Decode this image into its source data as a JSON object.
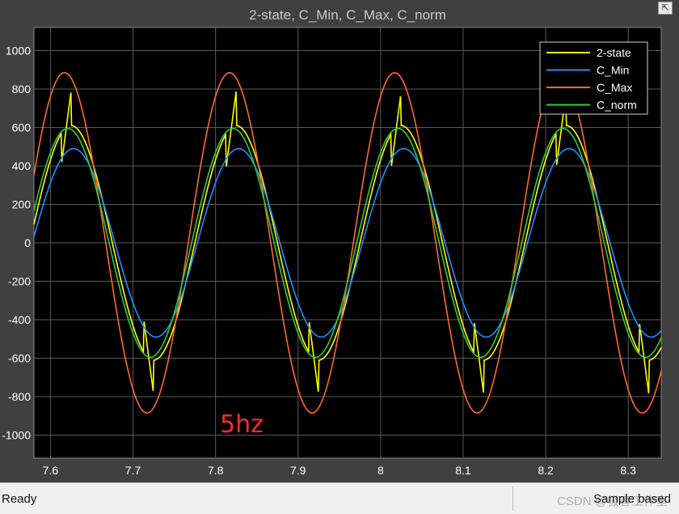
{
  "window": {
    "title": "2-state, C_Min, C_Max, C_norm",
    "undock_icon": "undock-icon"
  },
  "annotation": {
    "text": "5hz",
    "color": "#ff2a2a"
  },
  "status": {
    "left_text": "Ready",
    "right_text": "Sample based",
    "watermark": "CSDN @极客工作室"
  },
  "colors": {
    "plot_background": "#000000",
    "frame_background": "#404040",
    "grid": "#5a5a5a",
    "axis_text": "#ffffff",
    "title_text": "#c8c8c8"
  },
  "chart_data": {
    "type": "line",
    "title": "2-state, C_Min, C_Max, C_norm",
    "xlabel": "",
    "ylabel": "",
    "xlim": [
      7.58,
      8.34
    ],
    "ylim": [
      -1120,
      1120
    ],
    "xticks": [
      "7.6",
      "7.7",
      "7.8",
      "7.9",
      "8",
      "8.1",
      "8.2",
      "8.3"
    ],
    "xtick_values": [
      7.6,
      7.7,
      7.8,
      7.9,
      8.0,
      8.1,
      8.2,
      8.3
    ],
    "yticks": [
      "-1000",
      "-800",
      "-600",
      "-400",
      "-200",
      "0",
      "200",
      "400",
      "600",
      "800",
      "1000"
    ],
    "ytick_values": [
      -1000,
      -800,
      -600,
      -400,
      -200,
      0,
      200,
      400,
      600,
      800,
      1000
    ],
    "grid": true,
    "legend_position": "top-right",
    "frequency_hz": 5,
    "series": [
      {
        "name": "2-state",
        "color": "#ffff00",
        "amplitude": 610,
        "peak_time": 7.625,
        "jump_peak": 790,
        "jump_low": 395
      },
      {
        "name": "C_Min",
        "color": "#1e90ff",
        "amplitude": 490,
        "peak_time": 7.628
      },
      {
        "name": "C_Max",
        "color": "#ff6a2b",
        "amplitude": 885,
        "peak_time": 7.617
      },
      {
        "name": "C_norm",
        "color": "#32cd32",
        "amplitude": 595,
        "peak_time": 7.621
      }
    ]
  }
}
